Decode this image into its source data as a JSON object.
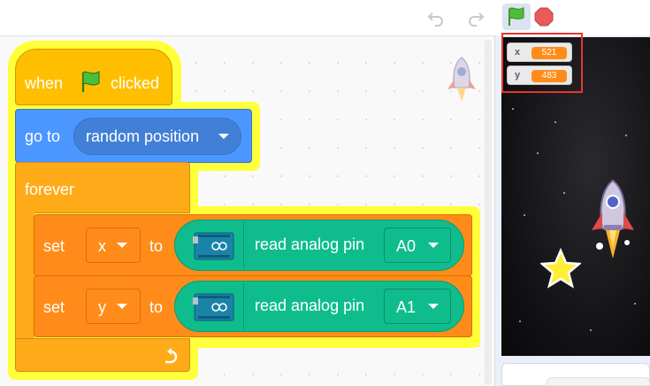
{
  "toolbar": {
    "undo_icon": "undo-icon",
    "redo_icon": "redo-icon",
    "green_flag_icon": "green-flag-icon",
    "stop_icon": "stop-sign-icon"
  },
  "script": {
    "hat": {
      "when": "when",
      "clicked": "clicked",
      "flag_icon": "green-flag-icon"
    },
    "goto": {
      "label": "go to",
      "target": "random position"
    },
    "forever": {
      "label": "forever",
      "loop_icon": "loop-arrow-icon"
    },
    "set_rows": [
      {
        "set": "set",
        "variable": "x",
        "to": "to",
        "reporter_label": "read analog pin",
        "pin": "A0",
        "board_icon": "arduino-board-icon"
      },
      {
        "set": "set",
        "variable": "y",
        "to": "to",
        "reporter_label": "read analog pin",
        "pin": "A1",
        "board_icon": "arduino-board-icon"
      }
    ]
  },
  "stage": {
    "monitors": [
      {
        "label": "x",
        "value": "521"
      },
      {
        "label": "y",
        "value": "483"
      }
    ],
    "sprites": [
      "rocket-sprite",
      "star-sprite"
    ]
  },
  "colors": {
    "events": "#ffbf00",
    "motion": "#4c97ff",
    "control": "#ffab19",
    "variables": "#ff8c1a",
    "extension": "#0fbd8c",
    "glow": "#ffff3a",
    "highlight": "#e8342e"
  }
}
